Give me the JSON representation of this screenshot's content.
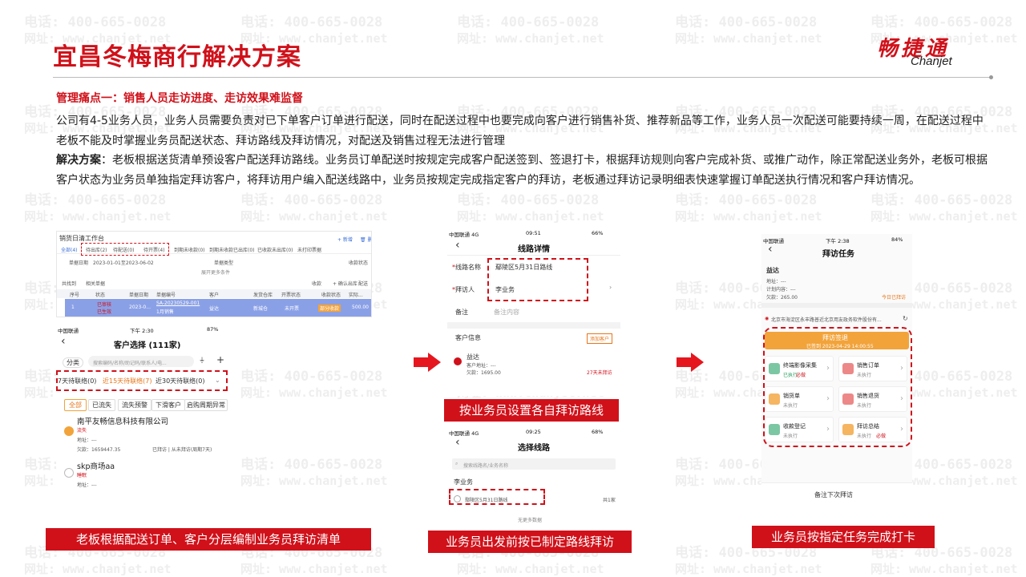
{
  "watermark": {
    "phone": "电话: 400-665-0028",
    "site": "网址: www.chanjet.net"
  },
  "title": "宜昌冬梅商行解决方案",
  "logo": {
    "cn": "畅捷通",
    "en": "Chanjet"
  },
  "pain_point": "管理痛点一：销售人员走访进度、走访效果难监督",
  "description": "公司有4-5业务人员，业务人员需要负责对已下单客户订单进行配送，同时在配送过程中也要完成向客户进行销售补货、推荐新品等工作，业务人员一次配送可能要持续一周，在配送过程中老板不能及时掌握业务员配送状态、拜访路线及拜访情况，对配送及销售过程无法进行管理",
  "solution": {
    "label": "解决方案",
    "text": "：老板根据送货清单预设客户配送拜访路线。业务员订单配送时按规定完成客户配送签到、签退打卡，根据拜访规则向客户完成补货、或推广动作，除正常配送业务外，老板可根据客户状态为业务员单独指定拜访客户，将拜访用户编入配送线路中，业务员按规定完成指定客户的拜访，老板通过拜访记录明细表快速掌握订单配送执行情况和客户拜访情况。"
  },
  "captions": {
    "left": "老板根据配送订单、客户分层编制业务员拜访清单",
    "middle_top": "按业务员设置各自拜访路线",
    "middle_bottom": "业务员出发前按已制定路线拜访",
    "right": "业务员按指定任务完成打卡"
  },
  "workbench": {
    "title": "销货日清工作台",
    "actions": [
      "+ 新增",
      "🗑 删除"
    ],
    "tabs": [
      "全部(4)",
      "待出库(2)",
      "待配送(0)",
      "待开票(4)",
      "到期未收款(0)",
      "到期未收款已出库(0)",
      "已收款未出库(0)",
      "未打印票据"
    ],
    "filter_label": "单据日期",
    "filter_value": "2023-01-01至2023-06-02",
    "filter_type_label": "单据类型",
    "filter_more": "收款状态",
    "expand_label": "展开更多条件",
    "count": "共找到",
    "bulk": "相关单据",
    "toolbar": [
      "收款",
      "+ 确认出库",
      "配送"
    ],
    "columns": [
      "序号",
      "状态",
      "单据日期",
      "单据编号",
      "客户",
      "发货仓库",
      "开票状态",
      "收款状态",
      "实际..."
    ],
    "row": {
      "index": "1",
      "status": [
        "已审核",
        "已生效"
      ],
      "date": "2023-0...",
      "code": "SA-20230529-001",
      "code_sub": "1月销售",
      "customer": "益达",
      "warehouse": "新城仓",
      "invoice": "未开票",
      "receipt": "部分收款",
      "amount": "500.00"
    }
  },
  "customer_select": {
    "status_carrier": "中国联通",
    "status_time": "下午 2:30",
    "status_battery": "87%",
    "title": "客户选择 (111家)",
    "category": "分类",
    "search_placeholder": "搜索编码/名称/助记码/联系人/电...",
    "ranges": [
      "7天待联络(0)",
      "近15天待联络(7)",
      "近30天待联络(0)"
    ],
    "chips": [
      "全部",
      "已流失",
      "流失预警",
      "下滑客户",
      "启购周期异常"
    ],
    "customers": [
      {
        "name": "南平友畅信息科技有限公司",
        "tag": "流失",
        "address": "地址：---",
        "debt": "欠款：1659447.35",
        "visit": "已拜访 | 从未拜访(周期7天)"
      },
      {
        "name": "skp商场aa",
        "tag": "睡眠",
        "address": "地址：---"
      }
    ]
  },
  "route_detail": {
    "status_carrier": "中国联通 4G",
    "status_time": "09:51",
    "status_battery": "66%",
    "title": "线路详情",
    "name_label": "线路名称",
    "name_value": "鄢陵区5月31日路线",
    "visitor_label": "拜访人",
    "visitor_value": "李业务",
    "note_label": "备注",
    "note_placeholder": "备注内容",
    "customer_info": "客户信息",
    "add_customer": "添加客户",
    "customer_name": "益达",
    "customer_addr": "客户地址：---",
    "customer_debt": "欠款：1695.00",
    "customer_days": "27天未拜访"
  },
  "route_select": {
    "status_carrier": "中国联通 4G",
    "status_time": "09:25",
    "status_battery": "68%",
    "title": "选择线路",
    "search_placeholder": "搜索线路名/业务名称",
    "group": "李业务",
    "route": "鄢陵区5月31日路线",
    "route_count": "共1家",
    "footer": "无更多数据"
  },
  "visit_task": {
    "status_carrier": "中国联通",
    "status_time": "下午 2:38",
    "status_battery": "84%",
    "title": "拜访任务",
    "customer": "益达",
    "address": "地址：---",
    "plan_time": "计划内容：---",
    "debt": "欠款：265.00",
    "today": "今日已拜访",
    "location": "北京市海淀区永丰路普近北京用友政务软件股份有...",
    "checkin_title": "拜访签退",
    "checkin_sub": "已签到 2023-04-29 14:00:55",
    "tasks": [
      {
        "name": "终端影像采集",
        "state": "已执行",
        "extra": "必做"
      },
      {
        "name": "销售订单",
        "state": "未执行",
        "extra": ""
      },
      {
        "name": "销货单",
        "state": "未执行",
        "extra": ""
      },
      {
        "name": "销售退货",
        "state": "未执行",
        "extra": ""
      },
      {
        "name": "收款登记",
        "state": "未执行",
        "extra": ""
      },
      {
        "name": "拜访总结",
        "state": "未执行",
        "extra": "必做"
      }
    ],
    "footer": "备注下次拜访"
  },
  "colors": {
    "brand_red": "#d0111a",
    "orange": "#f2a33a",
    "highlight_row": "#8aa0e6"
  },
  "icons": [
    "right-arrow-icon",
    "back-chevron-icon",
    "search-icon",
    "checkbox-icon",
    "refresh-icon",
    "location-icon"
  ]
}
